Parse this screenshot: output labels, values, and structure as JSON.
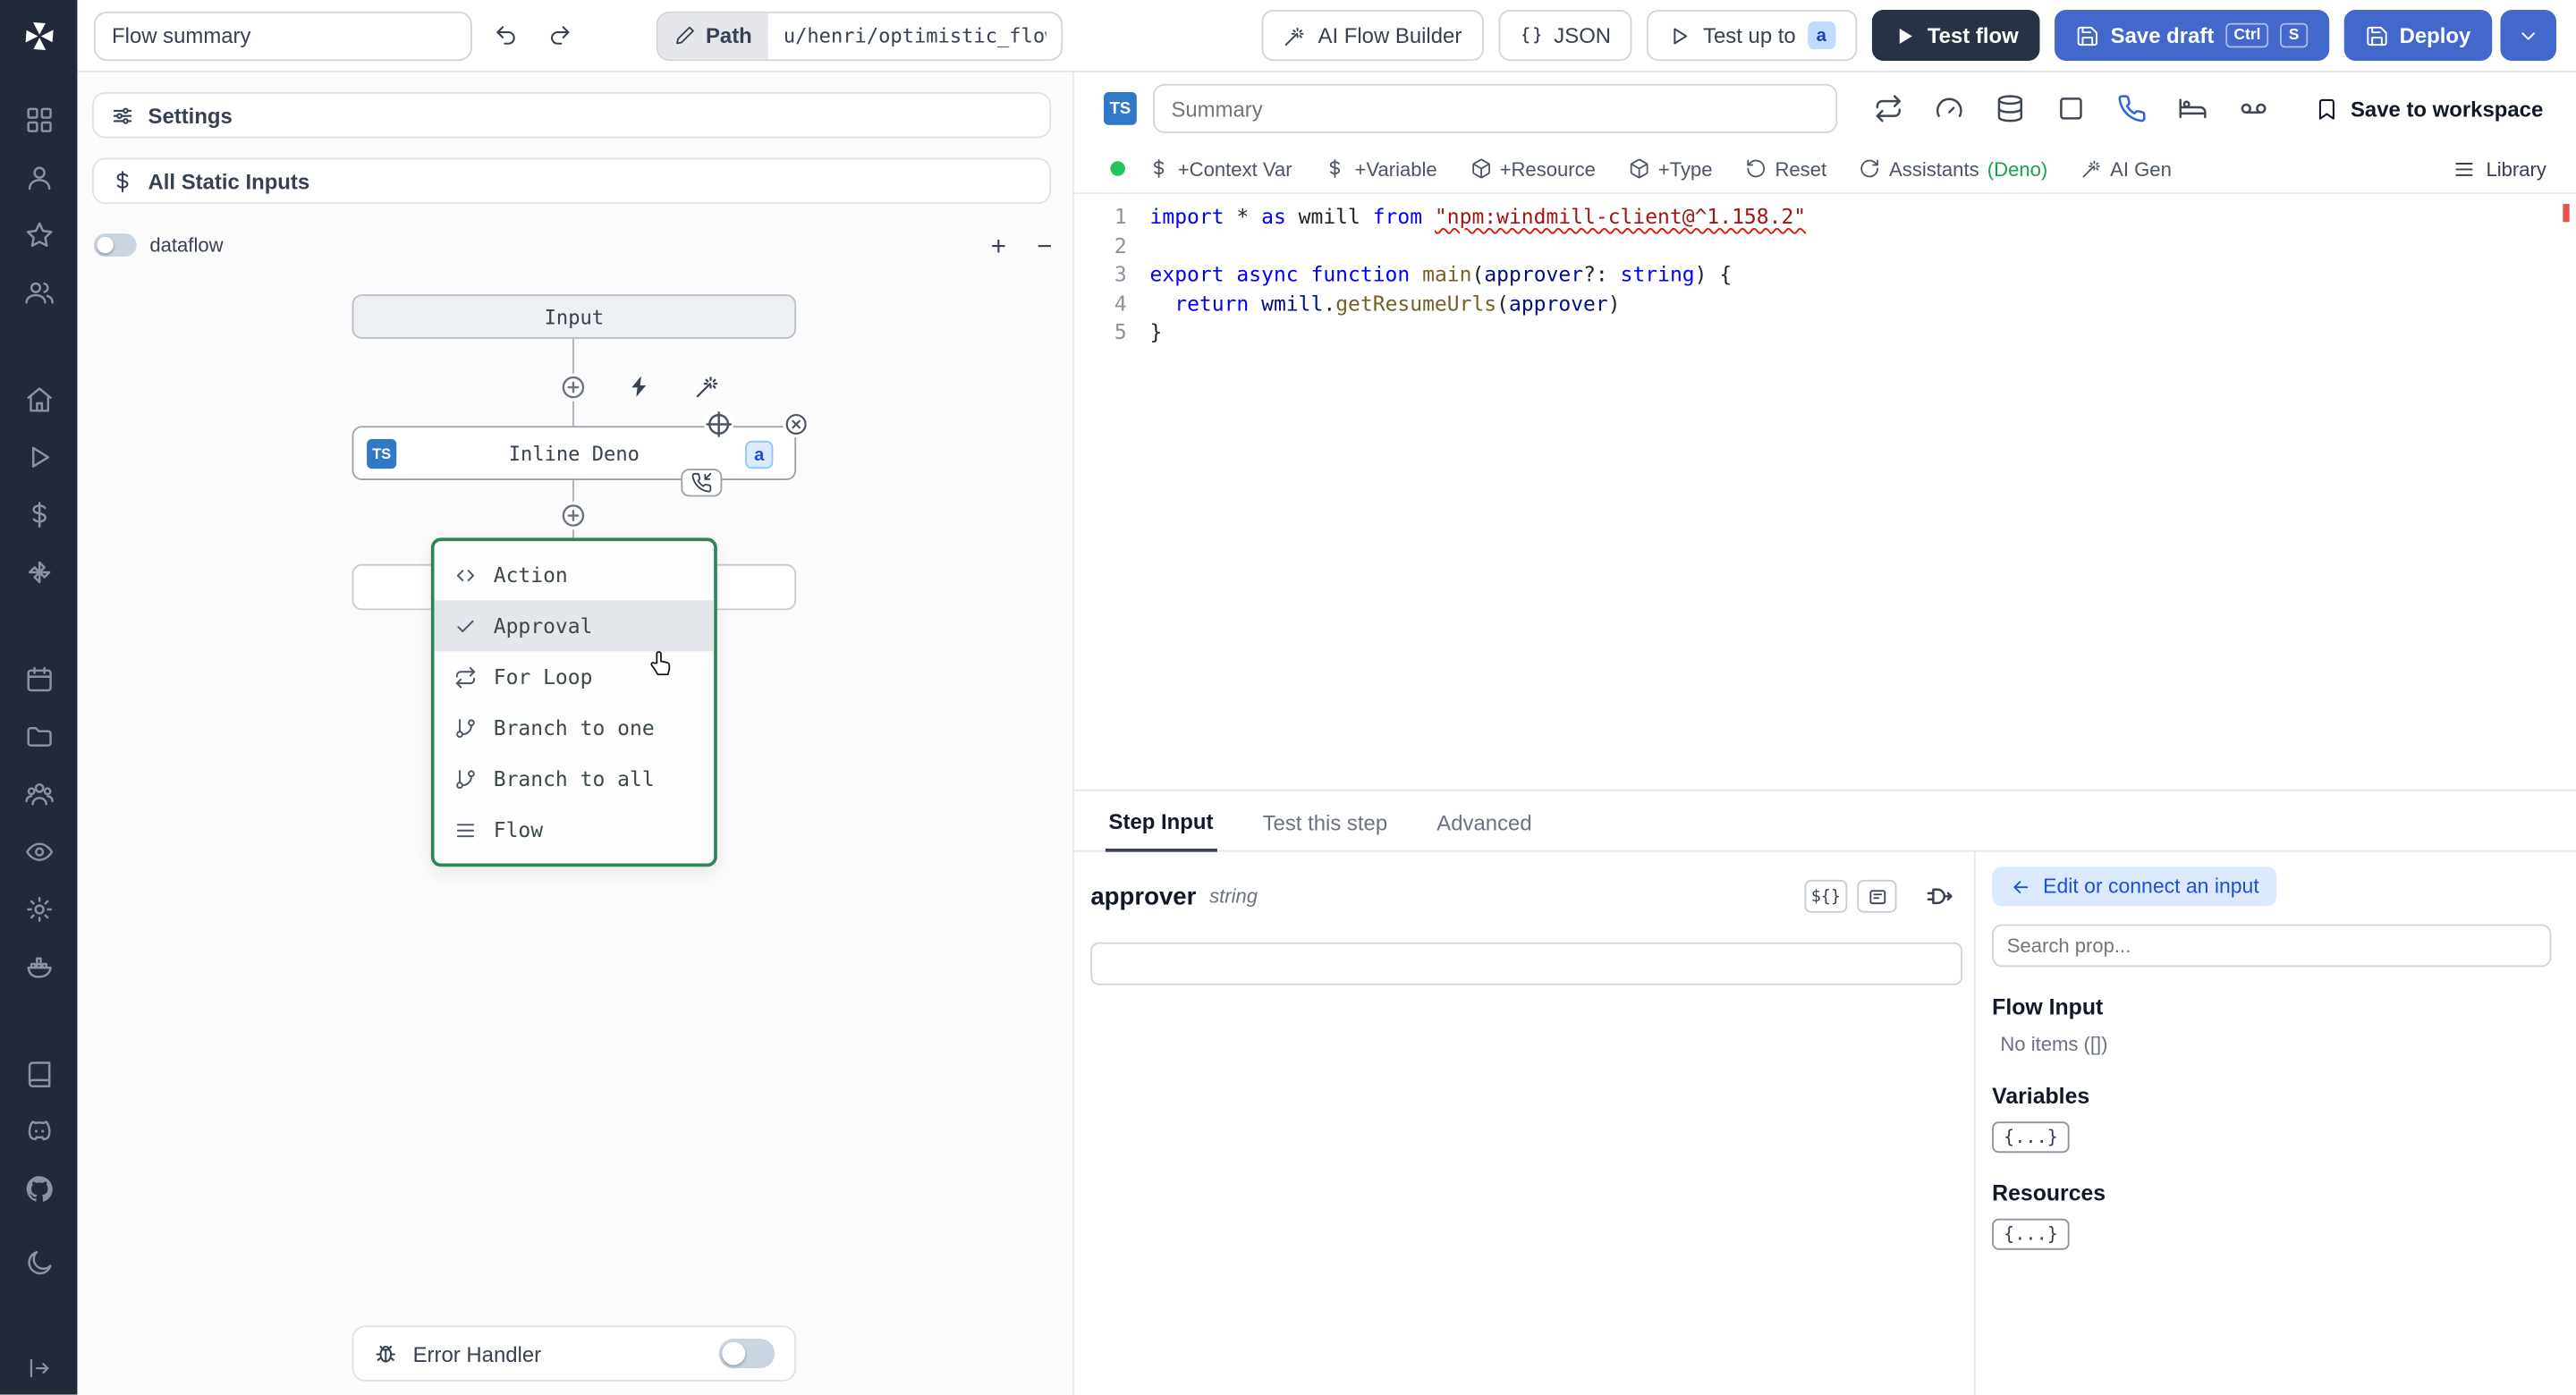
{
  "topbar": {
    "flow_summary": "Flow summary",
    "path_label": "Path",
    "path_value": "u/henri/optimistic_flow",
    "ai_flow_builder_label": "AI Flow Builder",
    "json_label": "JSON",
    "test_up_to_label": "Test up to",
    "test_up_to_badge": "a",
    "test_flow_label": "Test flow",
    "save_draft_label": "Save draft",
    "kbd_ctrl": "Ctrl",
    "kbd_s": "S",
    "deploy_label": "Deploy"
  },
  "sidebar": {
    "items": [
      {
        "icon": "apps-grid"
      },
      {
        "icon": "user"
      },
      {
        "icon": "star"
      },
      {
        "icon": "users"
      },
      {
        "icon": "home",
        "gap": "lg"
      },
      {
        "icon": "play"
      },
      {
        "icon": "dollar-sign"
      },
      {
        "icon": "windmill"
      },
      {
        "icon": "calendar",
        "gap": "lg"
      },
      {
        "icon": "folder"
      },
      {
        "icon": "team"
      },
      {
        "icon": "eye"
      },
      {
        "icon": "gear"
      },
      {
        "icon": "docker"
      },
      {
        "icon": "book",
        "gap": "lg"
      },
      {
        "icon": "discord"
      },
      {
        "icon": "github"
      },
      {
        "icon": "moon",
        "gap": "sm"
      }
    ]
  },
  "flow": {
    "settings_label": "Settings",
    "static_inputs_label": "All Static Inputs",
    "dataflow_label": "dataflow",
    "zoom_in": "+",
    "zoom_out": "−",
    "input_node_label": "Input",
    "deno_node_label": "Inline Deno",
    "deno_ts_badge": "TS",
    "deno_a_badge": "a",
    "menu_items": [
      {
        "icon": "code",
        "label": "Action"
      },
      {
        "icon": "check",
        "label": "Approval",
        "selected": true
      },
      {
        "icon": "repeat",
        "label": "For Loop"
      },
      {
        "icon": "git-branch",
        "label": "Branch to one"
      },
      {
        "icon": "git-branch",
        "label": "Branch to all"
      },
      {
        "icon": "list",
        "label": "Flow"
      }
    ],
    "error_handler_label": "Error Handler"
  },
  "editor": {
    "ts_badge": "TS",
    "summary_placeholder": "Summary",
    "header_icons": [
      {
        "icon": "repeat"
      },
      {
        "icon": "gauge"
      },
      {
        "icon": "database"
      },
      {
        "icon": "square"
      },
      {
        "icon": "phone",
        "active": true
      },
      {
        "icon": "bed"
      },
      {
        "icon": "voicemail"
      }
    ],
    "save_to_workspace_label": "Save to workspace",
    "toolbar_items": [
      {
        "icon": "dollar-sign",
        "label": "+Context Var"
      },
      {
        "icon": "dollar-sign",
        "label": "+Variable"
      },
      {
        "icon": "package",
        "label": "+Resource"
      },
      {
        "icon": "package",
        "label": "+Type"
      },
      {
        "icon": "rotate-ccw",
        "label": "Reset"
      },
      {
        "icon": "refresh-cw",
        "label": "Assistants",
        "suffix": "(Deno)"
      },
      {
        "icon": "wand",
        "label": "AI Gen"
      }
    ],
    "library_label": "Library",
    "code_lines": [
      {
        "n": "1",
        "tokens": [
          {
            "t": "import",
            "c": "kw"
          },
          {
            "t": " * ",
            "c": "pl"
          },
          {
            "t": "as",
            "c": "kw"
          },
          {
            "t": " wmill ",
            "c": "pl"
          },
          {
            "t": "from",
            "c": "kw"
          },
          {
            "t": " ",
            "c": "pl"
          },
          {
            "t": "\"npm:windmill-client@^1.158.2\"",
            "c": "str err"
          }
        ]
      },
      {
        "n": "2",
        "tokens": []
      },
      {
        "n": "3",
        "tokens": [
          {
            "t": "export",
            "c": "kw"
          },
          {
            "t": " ",
            "c": "pl"
          },
          {
            "t": "async",
            "c": "kw"
          },
          {
            "t": " ",
            "c": "pl"
          },
          {
            "t": "function",
            "c": "kw"
          },
          {
            "t": " ",
            "c": "pl"
          },
          {
            "t": "main",
            "c": "fn"
          },
          {
            "t": "(",
            "c": "pl"
          },
          {
            "t": "approver",
            "c": "vr"
          },
          {
            "t": "?: ",
            "c": "pl"
          },
          {
            "t": "string",
            "c": "kw"
          },
          {
            "t": ") {",
            "c": "pl"
          }
        ]
      },
      {
        "n": "4",
        "tokens": [
          {
            "t": "  ",
            "c": "pl"
          },
          {
            "t": "return",
            "c": "kw"
          },
          {
            "t": " ",
            "c": "pl"
          },
          {
            "t": "wmill",
            "c": "vr"
          },
          {
            "t": ".",
            "c": "pl"
          },
          {
            "t": "getResumeUrls",
            "c": "fn"
          },
          {
            "t": "(",
            "c": "pl"
          },
          {
            "t": "approver",
            "c": "vr"
          },
          {
            "t": ")",
            "c": "pl"
          }
        ]
      },
      {
        "n": "5",
        "tokens": [
          {
            "t": "}",
            "c": "pl"
          }
        ]
      }
    ]
  },
  "bottom": {
    "tabs": [
      {
        "label": "Step Input",
        "active": true
      },
      {
        "label": "Test this step"
      },
      {
        "label": "Advanced"
      }
    ],
    "field_name": "approver",
    "field_type": "string",
    "expr_chip": "${}",
    "edit_connect_label": "Edit or connect an input",
    "search_placeholder": "Search prop...",
    "flow_input_title": "Flow Input",
    "flow_input_empty": "No items ([])",
    "variables_title": "Variables",
    "variables_chip": "{...}",
    "resources_title": "Resources",
    "resources_chip": "{...}"
  },
  "colors": {
    "primary_blue": "#4268cc",
    "dark_button": "#273245",
    "menu_border_green": "#2f855a",
    "assistants_green": "#16a34a",
    "status_dot_green": "#22c55e",
    "error_marker_red": "#e5534b",
    "ts_badge_blue": "#3178c6",
    "sidebar_dark": "#222938"
  }
}
